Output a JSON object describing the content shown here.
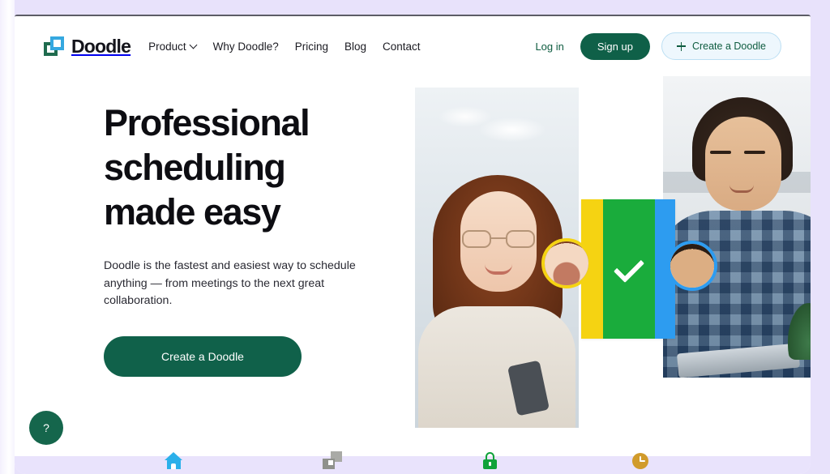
{
  "brand": {
    "name": "Doodle",
    "logo_icon": "doodle-squares-logo",
    "green": "#1f6b4e",
    "blue": "#35a8e0"
  },
  "header": {
    "nav": [
      {
        "label": "Product",
        "has_dropdown": true,
        "icon": "chevron-down-icon"
      },
      {
        "label": "Why Doodle?",
        "has_dropdown": false
      },
      {
        "label": "Pricing",
        "has_dropdown": false
      },
      {
        "label": "Blog",
        "has_dropdown": false
      },
      {
        "label": "Contact",
        "has_dropdown": false
      }
    ],
    "login_label": "Log in",
    "signup_label": "Sign up",
    "create_label": "Create a Doodle",
    "create_icon": "plus-icon"
  },
  "hero": {
    "headline_line1": "Professional",
    "headline_line2": "scheduling",
    "headline_line3": "made easy",
    "subcopy": "Doodle is the fastest and easiest way to schedule anything — from meetings to the next great collaboration.",
    "cta_label": "Create a Doodle",
    "cta_color": "#10614a"
  },
  "collage": {
    "left_photo_alt": "Woman with red hair and glasses holding a phone in an office",
    "right_photo_alt": "Man in a blue plaid shirt at a desk with a laptop",
    "card_icon": "checkmark-icon",
    "band_colors": [
      "#f5d312",
      "#1aac3c",
      "#2d9cf0"
    ],
    "avatar_left_ring": "#f5d312",
    "avatar_right_ring": "#2d9cf0",
    "avatar_left_alt": "Avatar of woman with red hair",
    "avatar_right_alt": "Avatar of man in plaid shirt"
  },
  "help": {
    "label": "?",
    "icon": "question-mark-icon",
    "color": "#15664c"
  },
  "icon_strip": [
    {
      "name": "home-icon",
      "color": "#2bb0ea"
    },
    {
      "name": "squares-icon",
      "color": "#a9aaa6"
    },
    {
      "name": "lock-icon",
      "color": "#0fa23a"
    },
    {
      "name": "clock-icon",
      "color": "#d19b2b"
    }
  ]
}
